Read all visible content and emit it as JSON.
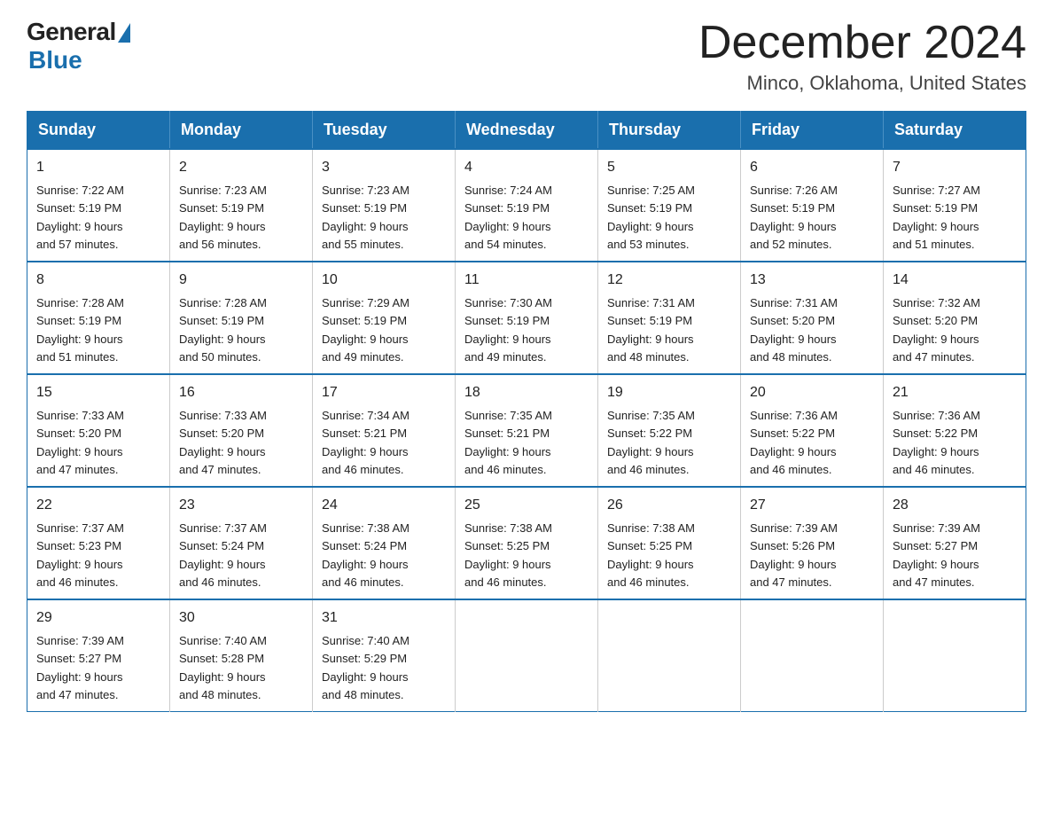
{
  "logo": {
    "general": "General",
    "blue": "Blue"
  },
  "title": {
    "month": "December 2024",
    "location": "Minco, Oklahoma, United States"
  },
  "days_of_week": [
    "Sunday",
    "Monday",
    "Tuesday",
    "Wednesday",
    "Thursday",
    "Friday",
    "Saturday"
  ],
  "weeks": [
    [
      {
        "day": "1",
        "sunrise": "7:22 AM",
        "sunset": "5:19 PM",
        "daylight": "9 hours and 57 minutes."
      },
      {
        "day": "2",
        "sunrise": "7:23 AM",
        "sunset": "5:19 PM",
        "daylight": "9 hours and 56 minutes."
      },
      {
        "day": "3",
        "sunrise": "7:23 AM",
        "sunset": "5:19 PM",
        "daylight": "9 hours and 55 minutes."
      },
      {
        "day": "4",
        "sunrise": "7:24 AM",
        "sunset": "5:19 PM",
        "daylight": "9 hours and 54 minutes."
      },
      {
        "day": "5",
        "sunrise": "7:25 AM",
        "sunset": "5:19 PM",
        "daylight": "9 hours and 53 minutes."
      },
      {
        "day": "6",
        "sunrise": "7:26 AM",
        "sunset": "5:19 PM",
        "daylight": "9 hours and 52 minutes."
      },
      {
        "day": "7",
        "sunrise": "7:27 AM",
        "sunset": "5:19 PM",
        "daylight": "9 hours and 51 minutes."
      }
    ],
    [
      {
        "day": "8",
        "sunrise": "7:28 AM",
        "sunset": "5:19 PM",
        "daylight": "9 hours and 51 minutes."
      },
      {
        "day": "9",
        "sunrise": "7:28 AM",
        "sunset": "5:19 PM",
        "daylight": "9 hours and 50 minutes."
      },
      {
        "day": "10",
        "sunrise": "7:29 AM",
        "sunset": "5:19 PM",
        "daylight": "9 hours and 49 minutes."
      },
      {
        "day": "11",
        "sunrise": "7:30 AM",
        "sunset": "5:19 PM",
        "daylight": "9 hours and 49 minutes."
      },
      {
        "day": "12",
        "sunrise": "7:31 AM",
        "sunset": "5:19 PM",
        "daylight": "9 hours and 48 minutes."
      },
      {
        "day": "13",
        "sunrise": "7:31 AM",
        "sunset": "5:20 PM",
        "daylight": "9 hours and 48 minutes."
      },
      {
        "day": "14",
        "sunrise": "7:32 AM",
        "sunset": "5:20 PM",
        "daylight": "9 hours and 47 minutes."
      }
    ],
    [
      {
        "day": "15",
        "sunrise": "7:33 AM",
        "sunset": "5:20 PM",
        "daylight": "9 hours and 47 minutes."
      },
      {
        "day": "16",
        "sunrise": "7:33 AM",
        "sunset": "5:20 PM",
        "daylight": "9 hours and 47 minutes."
      },
      {
        "day": "17",
        "sunrise": "7:34 AM",
        "sunset": "5:21 PM",
        "daylight": "9 hours and 46 minutes."
      },
      {
        "day": "18",
        "sunrise": "7:35 AM",
        "sunset": "5:21 PM",
        "daylight": "9 hours and 46 minutes."
      },
      {
        "day": "19",
        "sunrise": "7:35 AM",
        "sunset": "5:22 PM",
        "daylight": "9 hours and 46 minutes."
      },
      {
        "day": "20",
        "sunrise": "7:36 AM",
        "sunset": "5:22 PM",
        "daylight": "9 hours and 46 minutes."
      },
      {
        "day": "21",
        "sunrise": "7:36 AM",
        "sunset": "5:22 PM",
        "daylight": "9 hours and 46 minutes."
      }
    ],
    [
      {
        "day": "22",
        "sunrise": "7:37 AM",
        "sunset": "5:23 PM",
        "daylight": "9 hours and 46 minutes."
      },
      {
        "day": "23",
        "sunrise": "7:37 AM",
        "sunset": "5:24 PM",
        "daylight": "9 hours and 46 minutes."
      },
      {
        "day": "24",
        "sunrise": "7:38 AM",
        "sunset": "5:24 PM",
        "daylight": "9 hours and 46 minutes."
      },
      {
        "day": "25",
        "sunrise": "7:38 AM",
        "sunset": "5:25 PM",
        "daylight": "9 hours and 46 minutes."
      },
      {
        "day": "26",
        "sunrise": "7:38 AM",
        "sunset": "5:25 PM",
        "daylight": "9 hours and 46 minutes."
      },
      {
        "day": "27",
        "sunrise": "7:39 AM",
        "sunset": "5:26 PM",
        "daylight": "9 hours and 47 minutes."
      },
      {
        "day": "28",
        "sunrise": "7:39 AM",
        "sunset": "5:27 PM",
        "daylight": "9 hours and 47 minutes."
      }
    ],
    [
      {
        "day": "29",
        "sunrise": "7:39 AM",
        "sunset": "5:27 PM",
        "daylight": "9 hours and 47 minutes."
      },
      {
        "day": "30",
        "sunrise": "7:40 AM",
        "sunset": "5:28 PM",
        "daylight": "9 hours and 48 minutes."
      },
      {
        "day": "31",
        "sunrise": "7:40 AM",
        "sunset": "5:29 PM",
        "daylight": "9 hours and 48 minutes."
      },
      null,
      null,
      null,
      null
    ]
  ],
  "colors": {
    "header_bg": "#1a6fad",
    "header_text": "#ffffff",
    "border": "#1a6fad"
  }
}
